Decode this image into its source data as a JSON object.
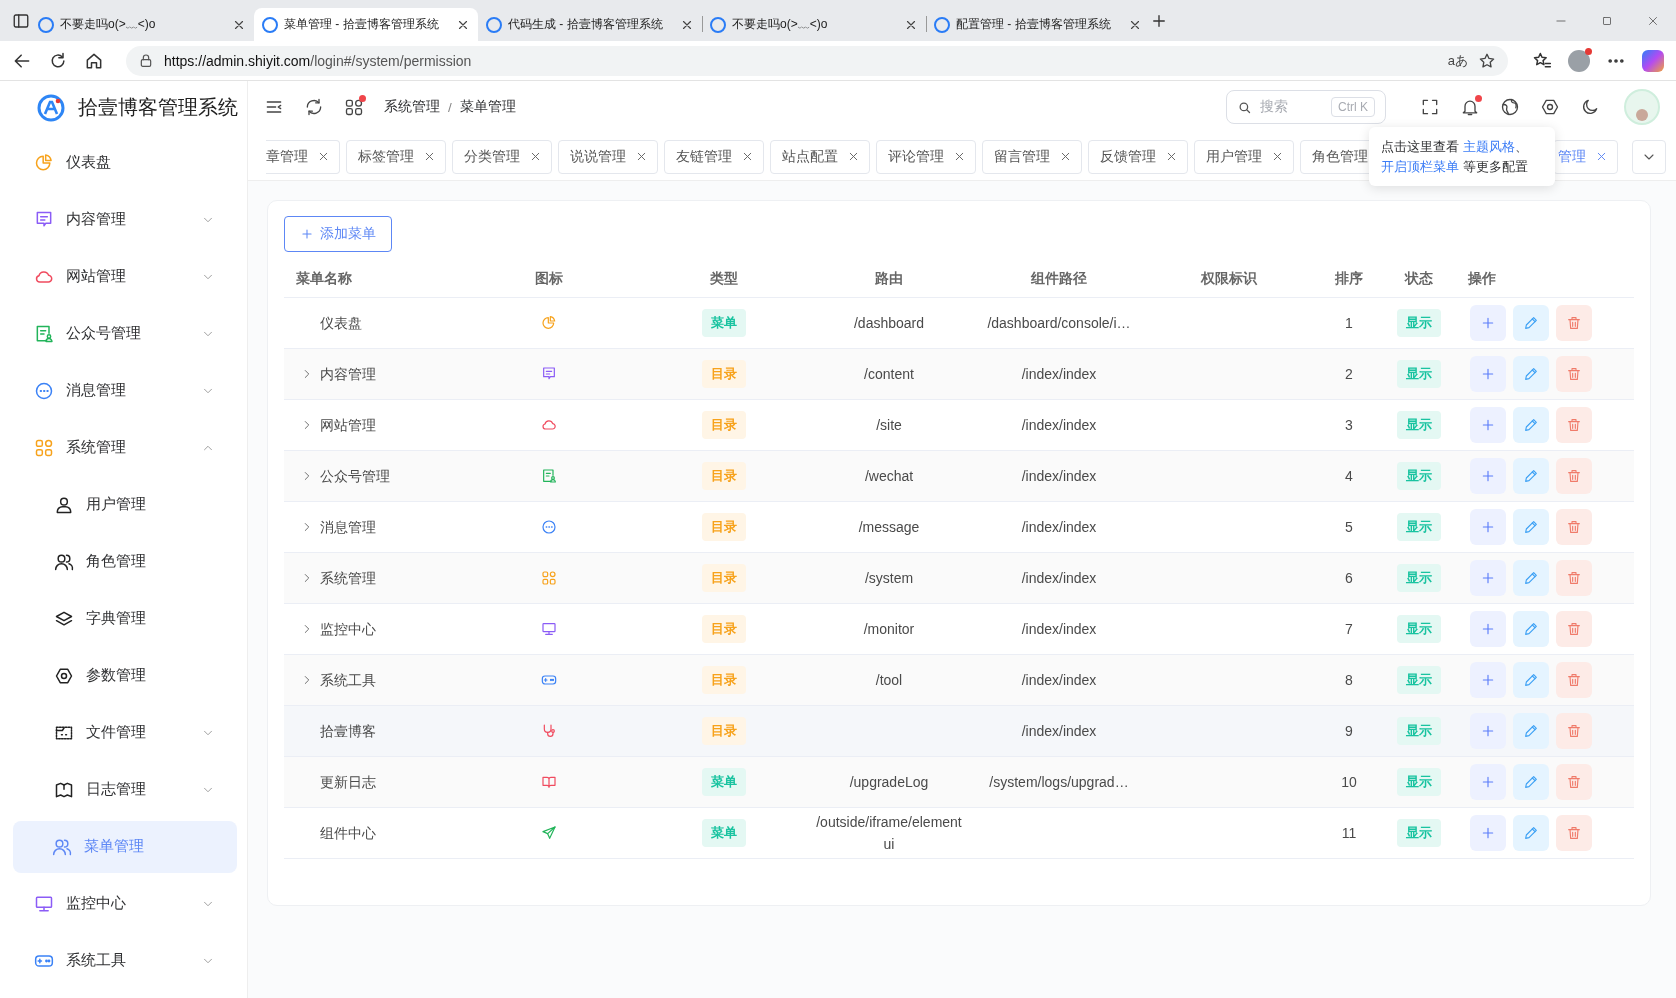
{
  "browser": {
    "tabs": [
      {
        "title": "不要走吗o(>﹏<)o",
        "selected": false
      },
      {
        "title": "菜单管理 - 拾壹博客管理系统",
        "selected": true
      },
      {
        "title": "代码生成 - 拾壹博客管理系统",
        "selected": false
      },
      {
        "title": "不要走吗o(>﹏<)o",
        "selected": false
      },
      {
        "title": "配置管理 - 拾壹博客管理系统",
        "selected": false
      }
    ],
    "url_host": "https://admin.shiyit.com",
    "url_path": "/login#/system/permission",
    "read_aloud": "aあ"
  },
  "app_title": "拾壹博客管理系统",
  "sidebar": {
    "items": [
      {
        "label": "仪表盘",
        "kind": "pie",
        "selected": false
      },
      {
        "label": "内容管理",
        "kind": "content",
        "selected": false,
        "expanded": false
      },
      {
        "label": "网站管理",
        "kind": "cloud",
        "selected": false,
        "expanded": false
      },
      {
        "label": "公众号管理",
        "kind": "wechat",
        "selected": false,
        "expanded": false
      },
      {
        "label": "消息管理",
        "kind": "message",
        "selected": false,
        "expanded": false
      },
      {
        "label": "系统管理",
        "kind": "system",
        "selected": false,
        "expanded": true,
        "children": [
          {
            "label": "用户管理",
            "kind": "user",
            "selected": false
          },
          {
            "label": "角色管理",
            "kind": "role",
            "selected": false
          },
          {
            "label": "字典管理",
            "kind": "layers",
            "selected": false
          },
          {
            "label": "参数管理",
            "kind": "hexagon",
            "selected": false
          },
          {
            "label": "文件管理",
            "kind": "file",
            "selected": false,
            "expanded": false
          },
          {
            "label": "日志管理",
            "kind": "book",
            "selected": false,
            "expanded": false
          },
          {
            "label": "菜单管理",
            "kind": "role",
            "selected": true
          }
        ]
      },
      {
        "label": "监控中心",
        "kind": "monitor",
        "selected": false,
        "expanded": false
      },
      {
        "label": "系统工具",
        "kind": "gamepad",
        "selected": false,
        "expanded": false
      }
    ]
  },
  "header": {
    "breadcrumb": [
      "系统管理",
      "菜单管理"
    ],
    "breadcrumb_separator": "/",
    "search": {
      "placeholder": "搜索",
      "shortcut": "Ctrl K"
    }
  },
  "page_tabs": [
    {
      "label": "章管理",
      "selected": false
    },
    {
      "label": "标签管理",
      "selected": false
    },
    {
      "label": "分类管理",
      "selected": false
    },
    {
      "label": "说说管理",
      "selected": false
    },
    {
      "label": "友链管理",
      "selected": false
    },
    {
      "label": "站点配置",
      "selected": false
    },
    {
      "label": "评论管理",
      "selected": false
    },
    {
      "label": "留言管理",
      "selected": false
    },
    {
      "label": "反馈管理",
      "selected": false
    },
    {
      "label": "用户管理",
      "selected": false
    },
    {
      "label": "角色管理",
      "selected": false
    },
    {
      "label": "管理",
      "selected": true
    }
  ],
  "tooltip": [
    {
      "kind": "text",
      "text": "点击这里查看 "
    },
    {
      "kind": "link",
      "text": "主题风格"
    },
    {
      "kind": "text",
      "text": "、"
    },
    {
      "kind": "link",
      "text": "开启顶栏菜单"
    },
    {
      "kind": "text",
      "text": " 等更多配置"
    }
  ],
  "add_button": "添加菜单",
  "table": {
    "columns": [
      "菜单名称",
      "图标",
      "类型",
      "路由",
      "组件路径",
      "权限标识",
      "排序",
      "状态",
      "操作"
    ],
    "rows": [
      {
        "name": "仪表盘",
        "has_children": false,
        "hovered": false,
        "kind": "pie",
        "type": {
          "label": "菜单",
          "kind": "menu"
        },
        "route": "/dashboard",
        "component": "/dashboard/console/i…",
        "sort": "1",
        "status": "显示"
      },
      {
        "name": "内容管理",
        "has_children": true,
        "hovered": false,
        "kind": "content",
        "type": {
          "label": "目录",
          "kind": "dir"
        },
        "route": "/content",
        "component": "/index/index",
        "sort": "2",
        "status": "显示"
      },
      {
        "name": "网站管理",
        "has_children": true,
        "hovered": false,
        "kind": "cloud",
        "type": {
          "label": "目录",
          "kind": "dir"
        },
        "route": "/site",
        "component": "/index/index",
        "sort": "3",
        "status": "显示"
      },
      {
        "name": "公众号管理",
        "has_children": true,
        "hovered": false,
        "kind": "wechat",
        "type": {
          "label": "目录",
          "kind": "dir"
        },
        "route": "/wechat",
        "component": "/index/index",
        "sort": "4",
        "status": "显示"
      },
      {
        "name": "消息管理",
        "has_children": true,
        "hovered": false,
        "kind": "message",
        "type": {
          "label": "目录",
          "kind": "dir"
        },
        "route": "/message",
        "component": "/index/index",
        "sort": "5",
        "status": "显示"
      },
      {
        "name": "系统管理",
        "has_children": true,
        "hovered": false,
        "kind": "system",
        "type": {
          "label": "目录",
          "kind": "dir"
        },
        "route": "/system",
        "component": "/index/index",
        "sort": "6",
        "status": "显示"
      },
      {
        "name": "监控中心",
        "has_children": true,
        "hovered": false,
        "kind": "monitor",
        "type": {
          "label": "目录",
          "kind": "dir"
        },
        "route": "/monitor",
        "component": "/index/index",
        "sort": "7",
        "status": "显示"
      },
      {
        "name": "系统工具",
        "has_children": true,
        "hovered": false,
        "kind": "gamepad",
        "type": {
          "label": "目录",
          "kind": "dir"
        },
        "route": "/tool",
        "component": "/index/index",
        "sort": "8",
        "status": "显示"
      },
      {
        "name": "拾壹博客",
        "has_children": false,
        "hovered": true,
        "kind": "stethoscope",
        "type": {
          "label": "目录",
          "kind": "dir"
        },
        "component": "/index/index",
        "sort": "9",
        "status": "显示"
      },
      {
        "name": "更新日志",
        "has_children": false,
        "hovered": false,
        "kind": "openbook",
        "type": {
          "label": "菜单",
          "kind": "menu"
        },
        "route": "/upgradeLog",
        "component": "/system/logs/upgrad…",
        "sort": "10",
        "status": "显示"
      },
      {
        "name": "组件中心",
        "has_children": false,
        "hovered": false,
        "kind": "send",
        "type": {
          "label": "菜单",
          "kind": "menu"
        },
        "route": "/outside/iframe/elementui",
        "sort": "11",
        "status": "显示"
      }
    ]
  }
}
